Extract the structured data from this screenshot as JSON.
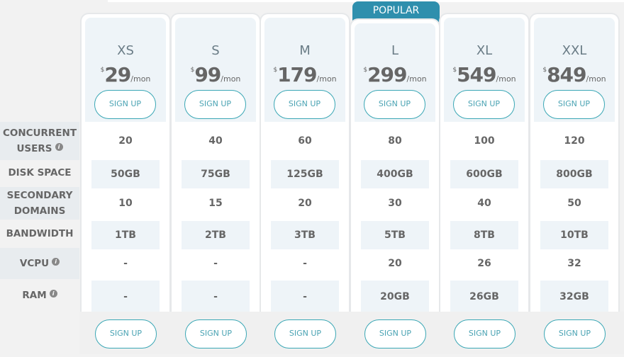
{
  "popular_label": "POPULAR",
  "signup_label": "SIGN UP",
  "currency": "$",
  "period": "/mon",
  "info_icon": "info-icon",
  "accent_color": "#3aa7b5",
  "popular_color": "#2e8fad",
  "features": [
    {
      "label_line1": "CONCURRENT",
      "label_line2": "USERS",
      "info": true
    },
    {
      "label_line1": "DISK SPACE",
      "label_line2": "",
      "info": false
    },
    {
      "label_line1": "SECONDARY",
      "label_line2": "DOMAINS",
      "info": false
    },
    {
      "label_line1": "BANDWIDTH",
      "label_line2": "",
      "info": false
    },
    {
      "label_line1": "VCPU",
      "label_line2": "",
      "info": true
    },
    {
      "label_line1": "RAM",
      "label_line2": "",
      "info": true
    }
  ],
  "plans": [
    {
      "name": "XS",
      "price": "29",
      "popular": false,
      "values": [
        "20",
        "50GB",
        "10",
        "1TB",
        "-",
        "-"
      ]
    },
    {
      "name": "S",
      "price": "99",
      "popular": false,
      "values": [
        "40",
        "75GB",
        "15",
        "2TB",
        "-",
        "-"
      ]
    },
    {
      "name": "M",
      "price": "179",
      "popular": false,
      "values": [
        "60",
        "125GB",
        "20",
        "3TB",
        "-",
        "-"
      ]
    },
    {
      "name": "L",
      "price": "299",
      "popular": true,
      "values": [
        "80",
        "400GB",
        "30",
        "5TB",
        "20",
        "20GB"
      ]
    },
    {
      "name": "XL",
      "price": "549",
      "popular": false,
      "values": [
        "100",
        "600GB",
        "40",
        "8TB",
        "26",
        "26GB"
      ]
    },
    {
      "name": "XXL",
      "price": "849",
      "popular": false,
      "values": [
        "120",
        "800GB",
        "50",
        "10TB",
        "32",
        "32GB"
      ]
    }
  ]
}
